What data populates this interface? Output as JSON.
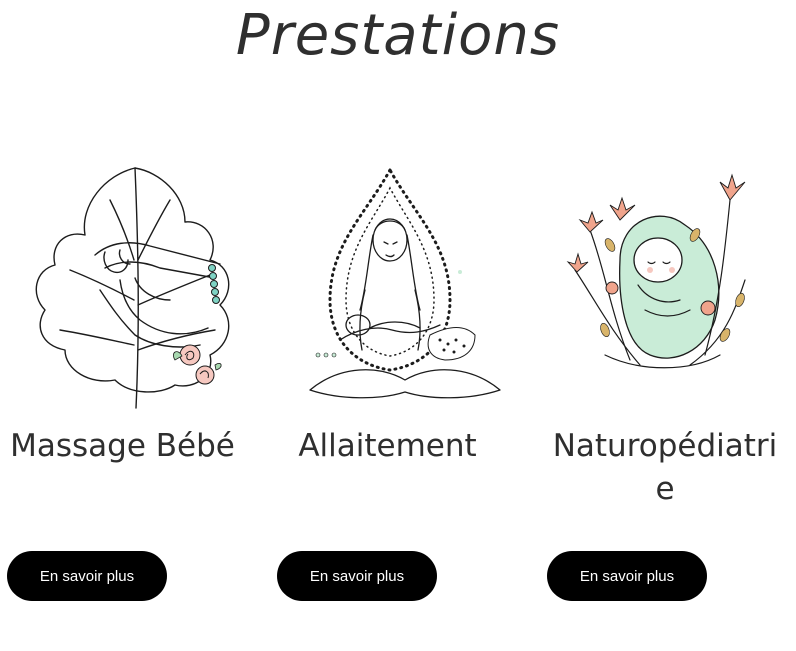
{
  "page": {
    "title": "Prestations"
  },
  "colors": {
    "button_bg": "#000000",
    "button_text": "#ffffff",
    "heading": "#2f2f2f",
    "accent_pink": "#f0a48c",
    "accent_mint": "#c9ecd7"
  },
  "services": [
    {
      "title": "Massage Bébé",
      "button_label": "En savoir plus",
      "icon": "massage-hands-leaf-illustration"
    },
    {
      "title": "Allaitement",
      "button_label": "En savoir plus",
      "icon": "breastfeeding-mother-illustration"
    },
    {
      "title": "Naturopédiatrie",
      "button_label": "En savoir plus",
      "icon": "baby-wrapped-flowers-illustration"
    }
  ]
}
